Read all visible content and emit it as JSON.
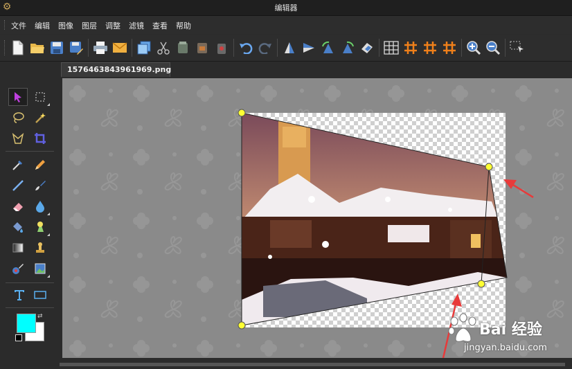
{
  "window": {
    "title": "编辑器"
  },
  "menu": {
    "items": [
      "文件",
      "编辑",
      "图像",
      "图层",
      "调整",
      "滤镜",
      "查看",
      "帮助"
    ]
  },
  "toolbar": {
    "buttons": [
      "new-file-icon",
      "open-folder-icon",
      "save-icon",
      "save-as-icon",
      "print-icon",
      "email-icon",
      "layers-icon",
      "cut-icon",
      "copy-icon",
      "paste-icon",
      "delete-icon",
      "undo-icon",
      "redo-icon",
      "flip-vertical-icon",
      "flip-horizontal-icon",
      "rotate-left-icon",
      "rotate-right-icon",
      "rotate-free-icon",
      "grid-icon",
      "hash-grid-icon",
      "hash-grid-2-icon",
      "hash-grid-3-icon",
      "zoom-in-icon",
      "zoom-out-icon",
      "select-tool-icon"
    ]
  },
  "document": {
    "tab_label": "1576463843961969.png *"
  },
  "toolbox": {
    "tools": [
      "move-icon",
      "rect-select-icon",
      "lasso-icon",
      "magic-wand-icon",
      "polygon-lasso-icon",
      "crop-icon",
      "eyedropper-icon",
      "pencil-icon",
      "line-icon",
      "brush-icon",
      "eraser-icon",
      "blur-drop-icon",
      "fill-bucket-icon",
      "color-replace-icon",
      "gradient-icon",
      "clone-stamp-icon",
      "recolor-icon",
      "image-icon",
      "text-icon",
      "rectangle-shape-icon"
    ]
  },
  "colors": {
    "primary": "#00ffff",
    "secondary": "#ffffff",
    "accent_arrow": "#e83a3a",
    "handle": "#ffff33"
  },
  "watermark": {
    "text": "Bai 经验",
    "url": "jingyan.baidu.com"
  }
}
